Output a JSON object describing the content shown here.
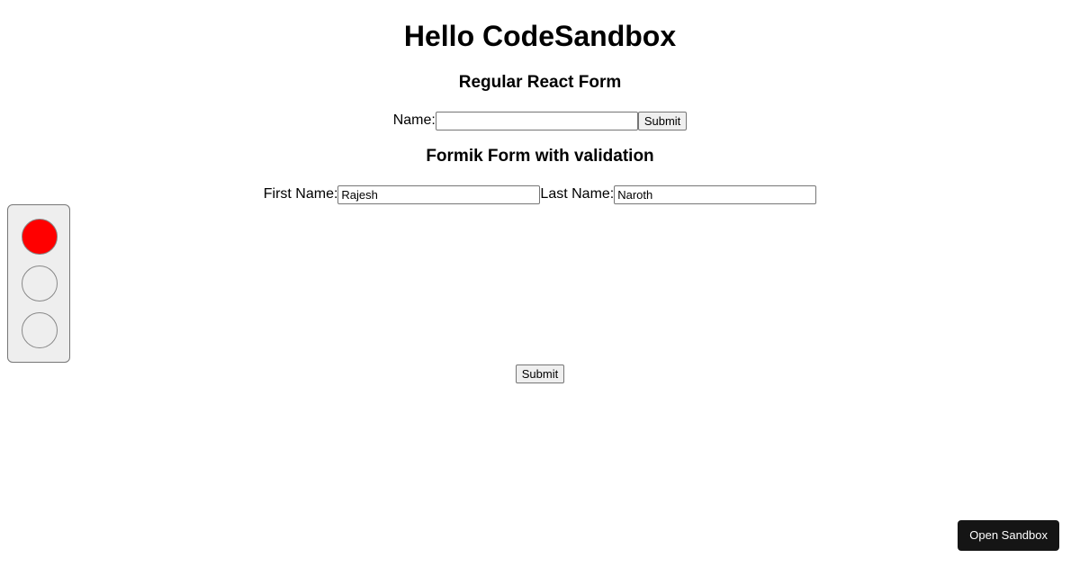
{
  "header": {
    "title": "Hello CodeSandbox"
  },
  "regular_form": {
    "heading": "Regular React Form",
    "name_label": "Name:",
    "name_value": "",
    "submit_label": "Submit"
  },
  "formik_form": {
    "heading": "Formik Form with validation",
    "first_name_label": "First Name:",
    "first_name_value": "Rajesh",
    "last_name_label": "Last Name:",
    "last_name_value": "Naroth",
    "submit_label": "Submit"
  },
  "traffic_light": {
    "active": "red",
    "colors": {
      "red": "#ff0000",
      "off": "#eeeeee"
    }
  },
  "sandbox": {
    "open_label": "Open Sandbox"
  }
}
